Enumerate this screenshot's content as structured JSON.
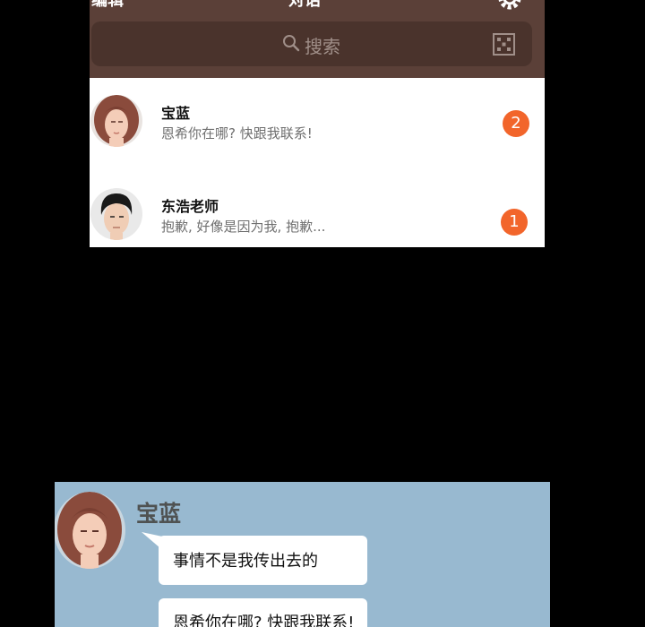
{
  "topbar": {
    "left_label": "编辑",
    "title": "对话",
    "settings_icon": "gear-icon"
  },
  "search": {
    "placeholder": "搜索",
    "icon": "search-icon",
    "qr_icon": "qr-code-icon"
  },
  "chats": [
    {
      "name": "宝蓝",
      "message": "恩希你在哪? 快跟我联系!",
      "unread": "2",
      "avatar": "woman-avatar"
    },
    {
      "name": "东浩老师",
      "message": "抱歉, 好像是因为我, 抱歉...",
      "unread": "1",
      "avatar": "man-avatar"
    }
  ],
  "conversation": {
    "sender": "宝蓝",
    "messages": [
      "事情不是我传出去的",
      "恩希你在哪? 快跟我联系!"
    ]
  },
  "colors": {
    "topbar": "#5b4038",
    "search_box": "#4a332c",
    "badge": "#f2652b",
    "chat_bg": "#98b9d0",
    "background": "#000000"
  }
}
